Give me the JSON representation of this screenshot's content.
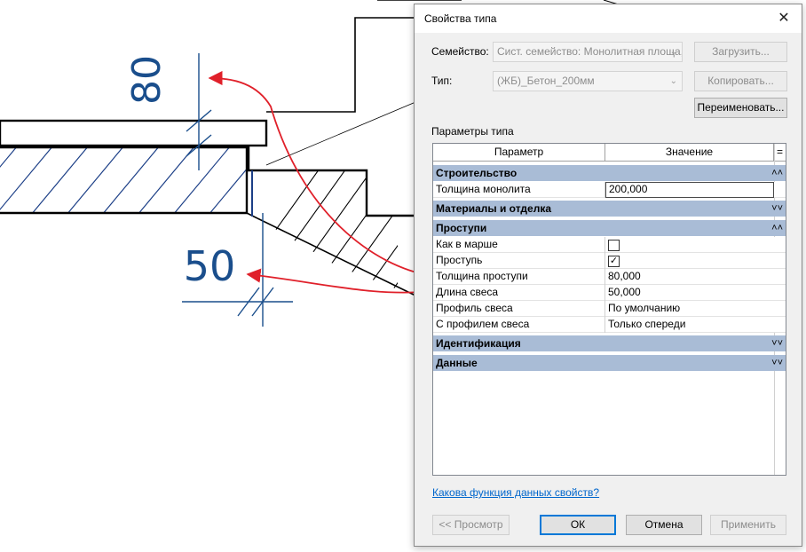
{
  "drawing": {
    "dim_top": "80",
    "dim_bottom": "50"
  },
  "dialog": {
    "title": "Свойства типа",
    "close_glyph": "✕",
    "family_label": "Семейство:",
    "family_value": "Сист. семейство: Монолитная площа,",
    "type_label": "Тип:",
    "type_value": "(ЖБ)_Бетон_200мм",
    "load_button": "Загрузить...",
    "copy_button": "Копировать...",
    "rename_button": "Переименовать...",
    "params_label": "Параметры типа",
    "grid": {
      "col_param": "Параметр",
      "col_value": "Значение",
      "col_extra": "=",
      "cat_construction": "Строительство",
      "row_thickness": {
        "name": "Толщина монолита",
        "value": "200,000"
      },
      "cat_materials": "Материалы и отделка",
      "cat_treads": "Проступи",
      "row_as_in_flight": {
        "name": "Как в марше",
        "checked": false
      },
      "row_tread": {
        "name": "Проступь",
        "checked": true
      },
      "row_tread_thickness": {
        "name": "Толщина проступи",
        "value": "80,000"
      },
      "row_overhang_length": {
        "name": "Длина свеса",
        "value": "50,000"
      },
      "row_overhang_profile": {
        "name": "Профиль свеса",
        "value": "По умолчанию"
      },
      "row_with_profile": {
        "name": "С профилем свеса",
        "value": "Только спереди"
      },
      "cat_identity": "Идентификация",
      "cat_data": "Данные",
      "chevron_up": "˄˄",
      "chevron_down": "˅˅",
      "check_mark": "✓"
    },
    "help_link": "Какова функция данных свойств?",
    "preview_button": "<< Просмотр",
    "ok_button": "ОК",
    "cancel_button": "Отмена",
    "apply_button": "Применить"
  },
  "colors": {
    "dimension": "#1a4e8c",
    "annotation_arrow": "#e0202a",
    "category_row": "#a9bcd6",
    "link": "#0066cc"
  }
}
